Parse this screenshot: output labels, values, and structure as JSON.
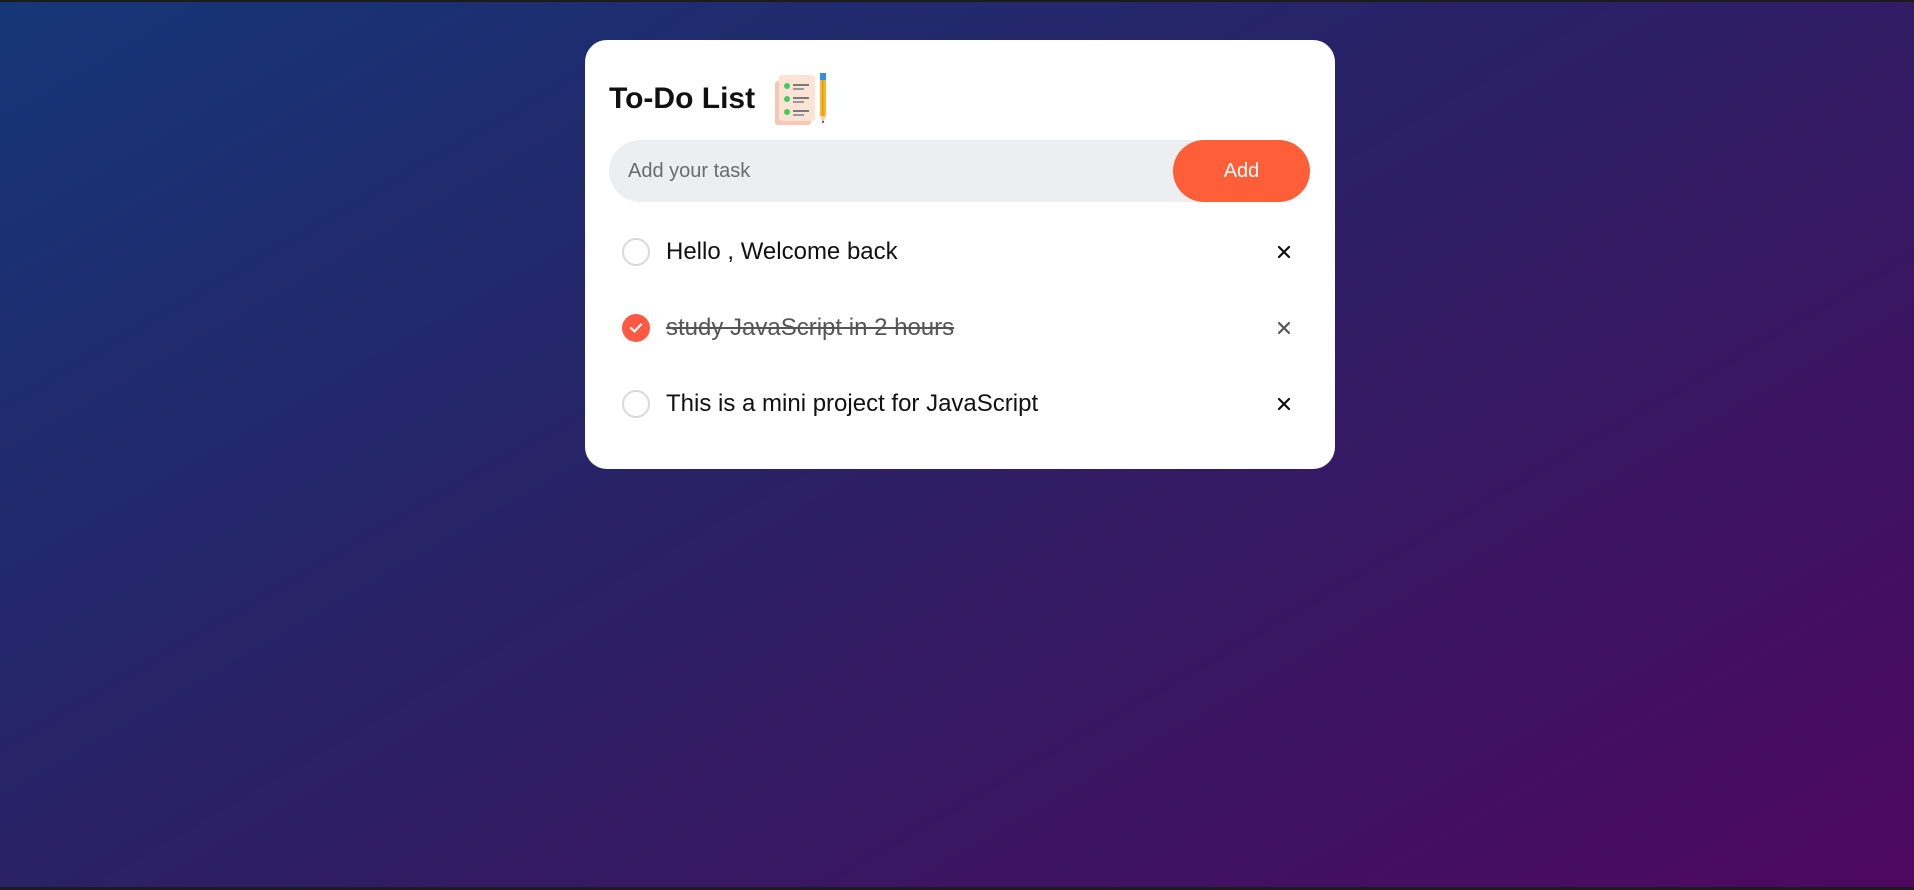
{
  "app": {
    "title": "To-Do List",
    "title_icon": "checklist-pencil-icon"
  },
  "input": {
    "placeholder": "Add your task",
    "value": ""
  },
  "add_button": {
    "label": "Add"
  },
  "tasks": [
    {
      "text": "Hello , Welcome back",
      "checked": false
    },
    {
      "text": "study JavaScript in 2 hours",
      "checked": true
    },
    {
      "text": "This is a mini project for JavaScript",
      "checked": false
    }
  ],
  "colors": {
    "accent": "#ff5f38",
    "checked": "#ff5945",
    "gradient_start": "#153677",
    "gradient_end": "#4e085f"
  },
  "icons": {
    "check": "check-icon",
    "remove": "close-icon"
  }
}
